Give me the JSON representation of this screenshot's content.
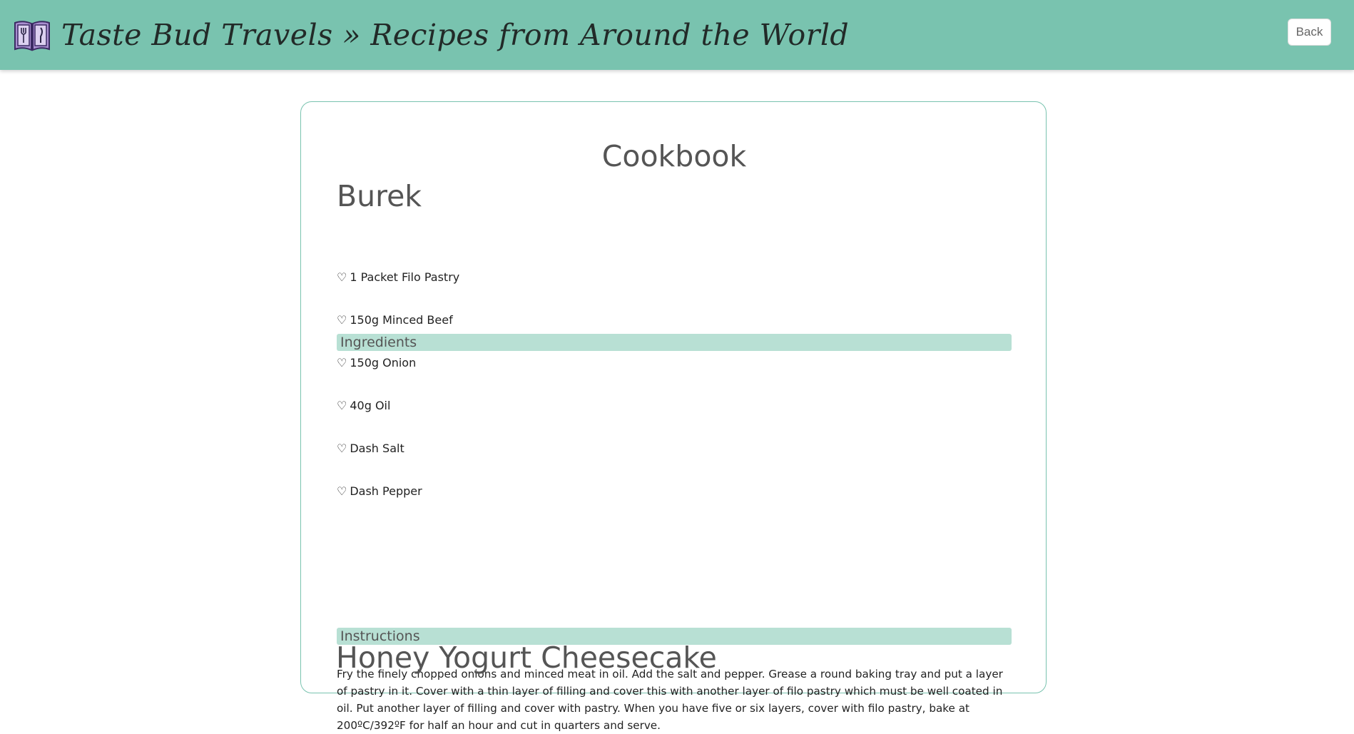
{
  "header": {
    "title": "Taste Bud Travels » Recipes from Around the World",
    "logo_icon": "recipe-book-icon",
    "back_label": "Back",
    "bg_color": "#79c3af"
  },
  "main": {
    "heading": "Cookbook",
    "recipes": [
      {
        "title": "Burek",
        "ingredients_label": "Ingredients",
        "ingredients": [
          "1 Packet Filo Pastry",
          "150g Minced Beef",
          "150g Onion",
          "40g Oil",
          "Dash Salt",
          "Dash Pepper"
        ],
        "instructions_label": "Instructions",
        "instructions": "Fry the finely chopped onions and minced meat in oil. Add the salt and pepper. Grease a round baking tray and put a layer of pastry in it. Cover with a thin layer of filling and cover this with another layer of filo pastry which must be well coated in oil. Put another layer of filling and cover with pastry. When you have five or six layers, cover with filo pastry, bake at 200ºC/392ºF for half an hour and cut in quarters and serve."
      },
      {
        "title": "Honey Yogurt Cheesecake"
      }
    ],
    "bullet_glyph": "♡",
    "accent_color": "#b8e0d4"
  }
}
